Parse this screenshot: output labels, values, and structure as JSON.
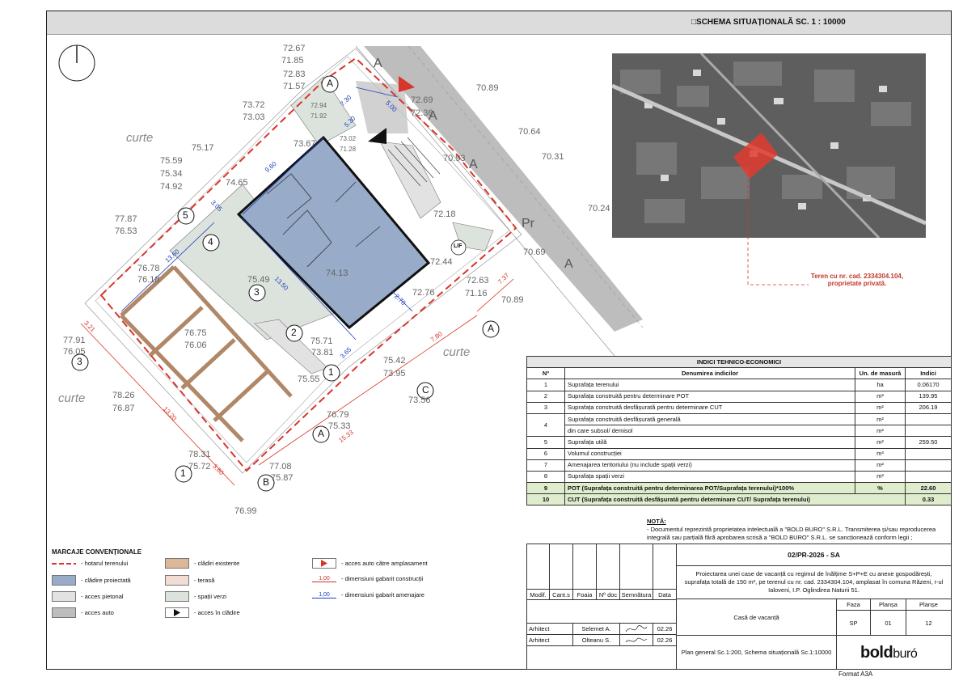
{
  "sheet_title": "□SCHEMA SITUAȚIONALĂ  SC. 1 : 10000",
  "north_symbol": "north-arrow-icon",
  "colors": {
    "boundary": "#d9352b",
    "building": "#98abc8",
    "pedestrian": "#e2e2e2",
    "auto": "#bdbdbd",
    "existing": "#dcb898",
    "terrace": "#f1ddd3",
    "green": "#dce3dc",
    "dim_build": "#c0392b",
    "dim_site": "#1f3fbf"
  },
  "plan": {
    "elevations": [
      {
        "id": "e1",
        "text": "72.67"
      },
      {
        "id": "e2",
        "text": "71.85"
      },
      {
        "id": "e3",
        "text": "72.83"
      },
      {
        "id": "e4",
        "text": "71.57"
      },
      {
        "id": "e5",
        "text": "73.72"
      },
      {
        "id": "e6",
        "text": "73.03"
      },
      {
        "id": "e7",
        "text": "72.94"
      },
      {
        "id": "e8",
        "text": "71.92"
      },
      {
        "id": "e9",
        "text": "75.17"
      },
      {
        "id": "e10",
        "text": "75.59"
      },
      {
        "id": "e11",
        "text": "75.34"
      },
      {
        "id": "e12",
        "text": "74.92"
      },
      {
        "id": "e13",
        "text": "73.67"
      },
      {
        "id": "e14",
        "text": "74.65"
      },
      {
        "id": "e15",
        "text": "77.87"
      },
      {
        "id": "e16",
        "text": "76.53"
      },
      {
        "id": "e17",
        "text": "76.78"
      },
      {
        "id": "e18",
        "text": "76.18"
      },
      {
        "id": "e19",
        "text": "77.91"
      },
      {
        "id": "e20",
        "text": "76.05"
      },
      {
        "id": "e21",
        "text": "75.49"
      },
      {
        "id": "e22",
        "text": "76.75"
      },
      {
        "id": "e23",
        "text": "76.06"
      },
      {
        "id": "e24",
        "text": "75.71"
      },
      {
        "id": "e25",
        "text": "73.81"
      },
      {
        "id": "e26",
        "text": "75.55"
      },
      {
        "id": "e27",
        "text": "75.42"
      },
      {
        "id": "e28",
        "text": "73.95"
      },
      {
        "id": "e29",
        "text": "73.56"
      },
      {
        "id": "e30",
        "text": "78.26"
      },
      {
        "id": "e31",
        "text": "76.87"
      },
      {
        "id": "e32",
        "text": "76.79"
      },
      {
        "id": "e33",
        "text": "75.33"
      },
      {
        "id": "e34",
        "text": "78.31"
      },
      {
        "id": "e35",
        "text": "75.72"
      },
      {
        "id": "e36",
        "text": "77.08"
      },
      {
        "id": "e37",
        "text": "75.87"
      },
      {
        "id": "e38",
        "text": "76.99"
      },
      {
        "id": "e39",
        "text": "70.89"
      },
      {
        "id": "e40",
        "text": "72.69"
      },
      {
        "id": "e41",
        "text": "72.36"
      },
      {
        "id": "e42",
        "text": "70.64"
      },
      {
        "id": "e43",
        "text": "70.93"
      },
      {
        "id": "e44",
        "text": "70.31"
      },
      {
        "id": "e45",
        "text": "70.24"
      },
      {
        "id": "e46",
        "text": "72.18"
      },
      {
        "id": "e47",
        "text": "72.44"
      },
      {
        "id": "e48",
        "text": "74.13"
      },
      {
        "id": "e49",
        "text": "72.76"
      },
      {
        "id": "e50",
        "text": "72.63"
      },
      {
        "id": "e51",
        "text": "71.16"
      },
      {
        "id": "e52",
        "text": "70.89"
      },
      {
        "id": "e53",
        "text": "70.69"
      },
      {
        "id": "e54",
        "text": "73.02"
      },
      {
        "id": "e55",
        "text": "71.28"
      }
    ],
    "curte_labels": [
      "curte",
      "curte",
      "curte"
    ],
    "dimensions": [
      "7.30",
      "5.00",
      "5.30",
      "9.60",
      "3.05",
      "13.60",
      "13.50",
      "2.70",
      "3.65",
      "7.80",
      "7.37",
      "13.20",
      "15.33",
      "3.80",
      "3.21"
    ],
    "markers": [
      "5",
      "4",
      "3",
      "2",
      "1",
      "3",
      "1",
      "A",
      "C",
      "A",
      "B",
      "A"
    ],
    "lift_label": "LIF",
    "road_letters": [
      "A",
      "A",
      "A",
      "Pr",
      "A"
    ]
  },
  "ortho": {
    "note": "Teren cu nr. cad. 2334304.104, proprietate privată."
  },
  "indici": {
    "title": "INDICI TEHNICO-ECONOMICI",
    "headers": [
      "Nº",
      "Denumirea indicilor",
      "Un. de masură",
      "Indici"
    ],
    "rows": [
      {
        "n": "1",
        "name": "Suprafața terenului",
        "unit": "ha",
        "val": "0.06170"
      },
      {
        "n": "2",
        "name": "Suprafața construită pentru determinare POT",
        "unit": "m²",
        "val": "139.95"
      },
      {
        "n": "3",
        "name": "Suprafața construită desfășurată pentru determinare CUT",
        "unit": "m²",
        "val": "206.19"
      },
      {
        "n": "4",
        "name": "Suprafața construită desfășurată generală",
        "unit": "m²",
        "val": ""
      },
      {
        "n": "",
        "name": "din care subsol/ demisol",
        "unit": "m²",
        "val": ""
      },
      {
        "n": "5",
        "name": "Suprafața utilă",
        "unit": "m²",
        "val": "259.50"
      },
      {
        "n": "6",
        "name": "Volumul construcției",
        "unit": "m³",
        "val": ""
      },
      {
        "n": "7",
        "name": "Amenajarea teritoriului (nu include spații verzi)",
        "unit": "m²",
        "val": ""
      },
      {
        "n": "8",
        "name": "Suprafața spații verzi",
        "unit": "m²",
        "val": ""
      }
    ],
    "pot": {
      "n": "9",
      "name": "POT (Suprafața construită pentru determinarea POT/Suprafața terenului)*100%",
      "unit": "%",
      "val": "22.60"
    },
    "cut": {
      "n": "10",
      "name": "CUT (Suprafața construită desfășurată pentru determinare CUT/ Suprafața terenului)",
      "unit": "",
      "val": "0.33"
    }
  },
  "nota": {
    "title": "NOTĂ:",
    "text": "- Documentul reprezintă proprietatea intelectuală a \"BOLD BURO\" S.R.L. Transmiterea și/sau reproducerea integrală sau parțială fără aprobarea scrisă a \"BOLD BURO\" S.R.L. se sancționează conform legii ;"
  },
  "legend": {
    "title": "MARCAJE CONVENȚIONALE",
    "items": [
      "- hotarul terenului",
      "- clădire proiectată",
      "- acces pietonal",
      "- acces auto",
      "- clădiri existente",
      "- terasă",
      "- spații verzi",
      "- acces în clădire",
      "- acces auto către amplasament",
      "- dimensiuni gabarit construcții",
      "- dimensiuni gabarit amenajare"
    ],
    "dim_value": "1,00"
  },
  "cartouche": {
    "code": "02/PR-2026 - SA",
    "description": "Proiectarea unei case de vacanță cu regimul de înălțime S+P+E cu anexe gospodărești, suprafața totală de 150 m², pe terenul cu nr. cad. 2334304.104, amplasat în comuna Răzeni, r-ul Ialoveni, I.P. Oglindirea Naturii 51.",
    "cols": [
      "Modif.",
      "Cant.s",
      "Foaia",
      "Nº doc",
      "Semnătura",
      "Data"
    ],
    "rows": [
      {
        "role": "Arhitect",
        "name": "Selemet A.",
        "date": "02.26"
      },
      {
        "role": "Arhitect",
        "name": "Olteanu S.",
        "date": "02.26"
      }
    ],
    "object": "Casă de vacanță",
    "faza_label": "Faza",
    "plansa_label": "Planșa",
    "planse_label": "Planșe",
    "faza": "SP",
    "plansa": "01",
    "planse": "12",
    "drawing": "Plan general Sc.1:200, Schema situațională Sc.1:10000",
    "logo_bold": "bold",
    "logo_buro": "buró",
    "format": "Format A3A"
  }
}
